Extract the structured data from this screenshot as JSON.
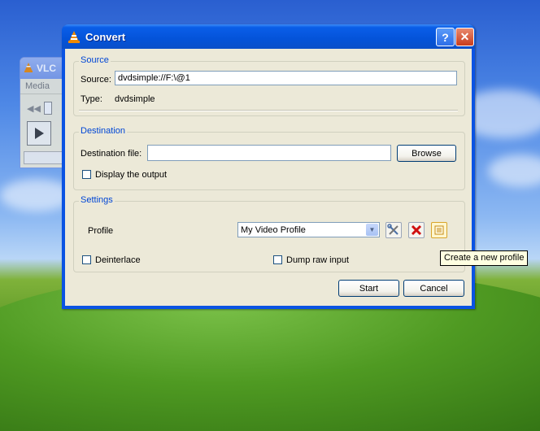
{
  "vlc_window": {
    "title": "VLC",
    "menu_item": "Media"
  },
  "dialog": {
    "title": "Convert",
    "help_button": "?",
    "close_button": "✕",
    "source": {
      "group_label": "Source",
      "source_label": "Source:",
      "source_value": "dvdsimple://F:\\@1",
      "type_label": "Type:",
      "type_value": "dvdsimple"
    },
    "destination": {
      "group_label": "Destination",
      "file_label": "Destination file:",
      "file_value": "",
      "browse_button": "Browse",
      "display_output_label": "Display the output",
      "display_output_checked": false
    },
    "settings": {
      "group_label": "Settings",
      "profile_label": "Profile",
      "profile_selected": "My Video Profile",
      "deinterlace_label": "Deinterlace",
      "deinterlace_checked": false,
      "dump_raw_label": "Dump raw input",
      "dump_raw_checked": false,
      "edit_icon": "wrench-screwdriver-icon",
      "delete_icon": "red-x-icon",
      "new_icon": "new-profile-icon"
    },
    "start_button": "Start",
    "cancel_button": "Cancel"
  },
  "tooltip": "Create a new profile",
  "colors": {
    "titlebar": "#0453d9",
    "group_label": "#0046d5",
    "dialog_bg": "#ece9d8",
    "vlc_orange": "#f08a00"
  }
}
